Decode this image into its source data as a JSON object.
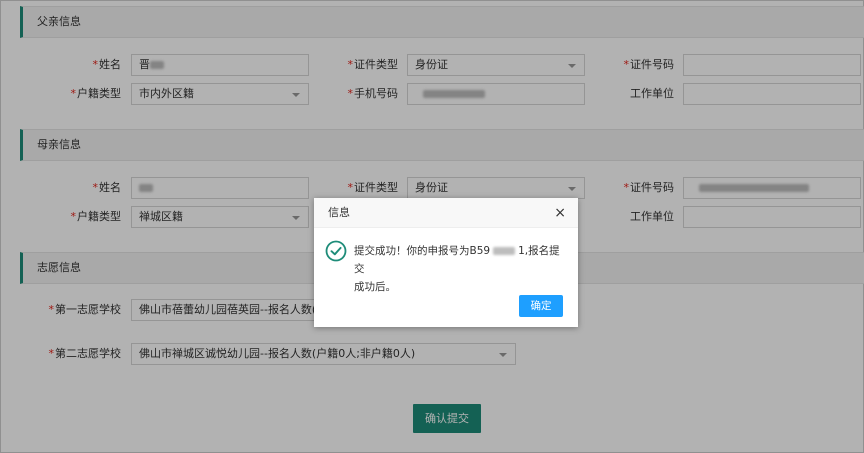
{
  "father": {
    "section_title": "父亲信息",
    "name_label": "姓名",
    "name_value": "晋",
    "id_type_label": "证件类型",
    "id_type_value": "身份证",
    "id_number_label": "证件号码",
    "id_number_value": "",
    "hukou_label": "户籍类型",
    "hukou_value": "市内外区籍",
    "phone_label": "手机号码",
    "work_label": "工作单位",
    "work_value": ""
  },
  "mother": {
    "section_title": "母亲信息",
    "name_label": "姓名",
    "id_type_label": "证件类型",
    "id_type_value": "身份证",
    "id_number_label": "证件号码",
    "hukou_label": "户籍类型",
    "hukou_value": "禅城区籍",
    "work_label": "工作单位",
    "work_value": ""
  },
  "wish": {
    "section_title": "志愿信息",
    "first_label": "第一志愿学校",
    "first_value": "佛山市蓓蕾幼儿园蓓英园--报名人数(户",
    "second_label": "第二志愿学校",
    "second_value": "佛山市禅城区诚悦幼儿园--报名人数(户籍0人;非户籍0人)"
  },
  "required_mark": "*",
  "submit_label": "确认提交",
  "dialog": {
    "title": "信息",
    "close": "×",
    "message_part1": "提交成功！你的申报号为B59",
    "message_part2": "1,报名提交",
    "message_line2": "成功后。",
    "ok_label": "确定"
  },
  "colors": {
    "accent": "#1e8c79",
    "dialog_button": "#1e9fff",
    "required": "#e2231a"
  }
}
